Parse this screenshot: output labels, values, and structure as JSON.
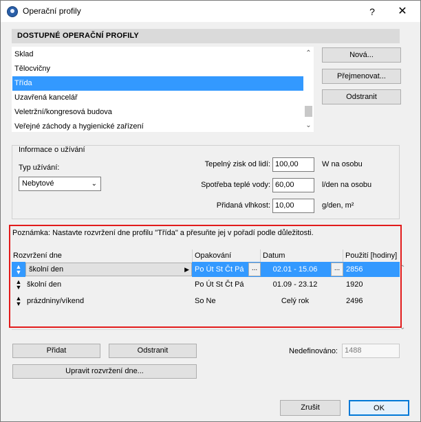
{
  "window": {
    "title": "Operační profily",
    "help_label": "?",
    "close_label": "✕"
  },
  "profiles": {
    "header": "DOSTUPNÉ OPERAČNÍ PROFILY",
    "items": [
      {
        "label": "Sklad"
      },
      {
        "label": "Tělocvičny"
      },
      {
        "label": "Třída"
      },
      {
        "label": "Uzavřená kancelář"
      },
      {
        "label": "Veletržní/kongresová budova"
      },
      {
        "label": "Veřejné záchody a hygienické zařízení"
      }
    ],
    "selected": "Třída",
    "buttons": {
      "new": "Nová...",
      "rename": "Přejmenovat...",
      "delete": "Odstranit"
    }
  },
  "usage": {
    "group_title": "Informace o užívání",
    "type_label": "Typ užívání:",
    "type_value": "Nebytové",
    "heat_gain_label": "Tepelný zisk od lidí:",
    "heat_gain_value": "100,00",
    "heat_gain_unit": "W na osobu",
    "hot_water_label": "Spotřeba teplé vody:",
    "hot_water_value": "60,00",
    "hot_water_unit": "l/den na osobu",
    "humidity_label": "Přidaná vlhkost:",
    "humidity_value": "10,00",
    "humidity_unit": "g/den, m²"
  },
  "schedule": {
    "note": "Poznámka: Nastavte rozvržení dne profilu \"Třída\" a přesuňte jej v pořadí podle důležitosti.",
    "columns": {
      "day": "Rozvržení dne",
      "repeat": "Opakování",
      "date": "Datum",
      "usage": "Použití [hodiny]"
    },
    "rows": [
      {
        "day": "školní den",
        "repeat": "Po Út St Čt Pá",
        "date": "02.01 - 15.06",
        "usage": "2856"
      },
      {
        "day": "školní den",
        "repeat": "Po Út St Čt Pá",
        "date": "01.09 - 23.12",
        "usage": "1920"
      },
      {
        "day": "prázdniny/víkend",
        "repeat": "So Ne",
        "date": "Celý rok",
        "usage": "2496"
      }
    ],
    "add_label": "Přidat",
    "delete_label": "Odstranit",
    "edit_label": "Upravit rozvržení dne...",
    "undefined_label": "Nedefinováno:",
    "undefined_value": "1488"
  },
  "footer": {
    "cancel": "Zrušit",
    "ok": "OK"
  },
  "colors": {
    "selection": "#3399ff",
    "highlight_border": "#e21a1a",
    "ok_border": "#0078d7"
  }
}
